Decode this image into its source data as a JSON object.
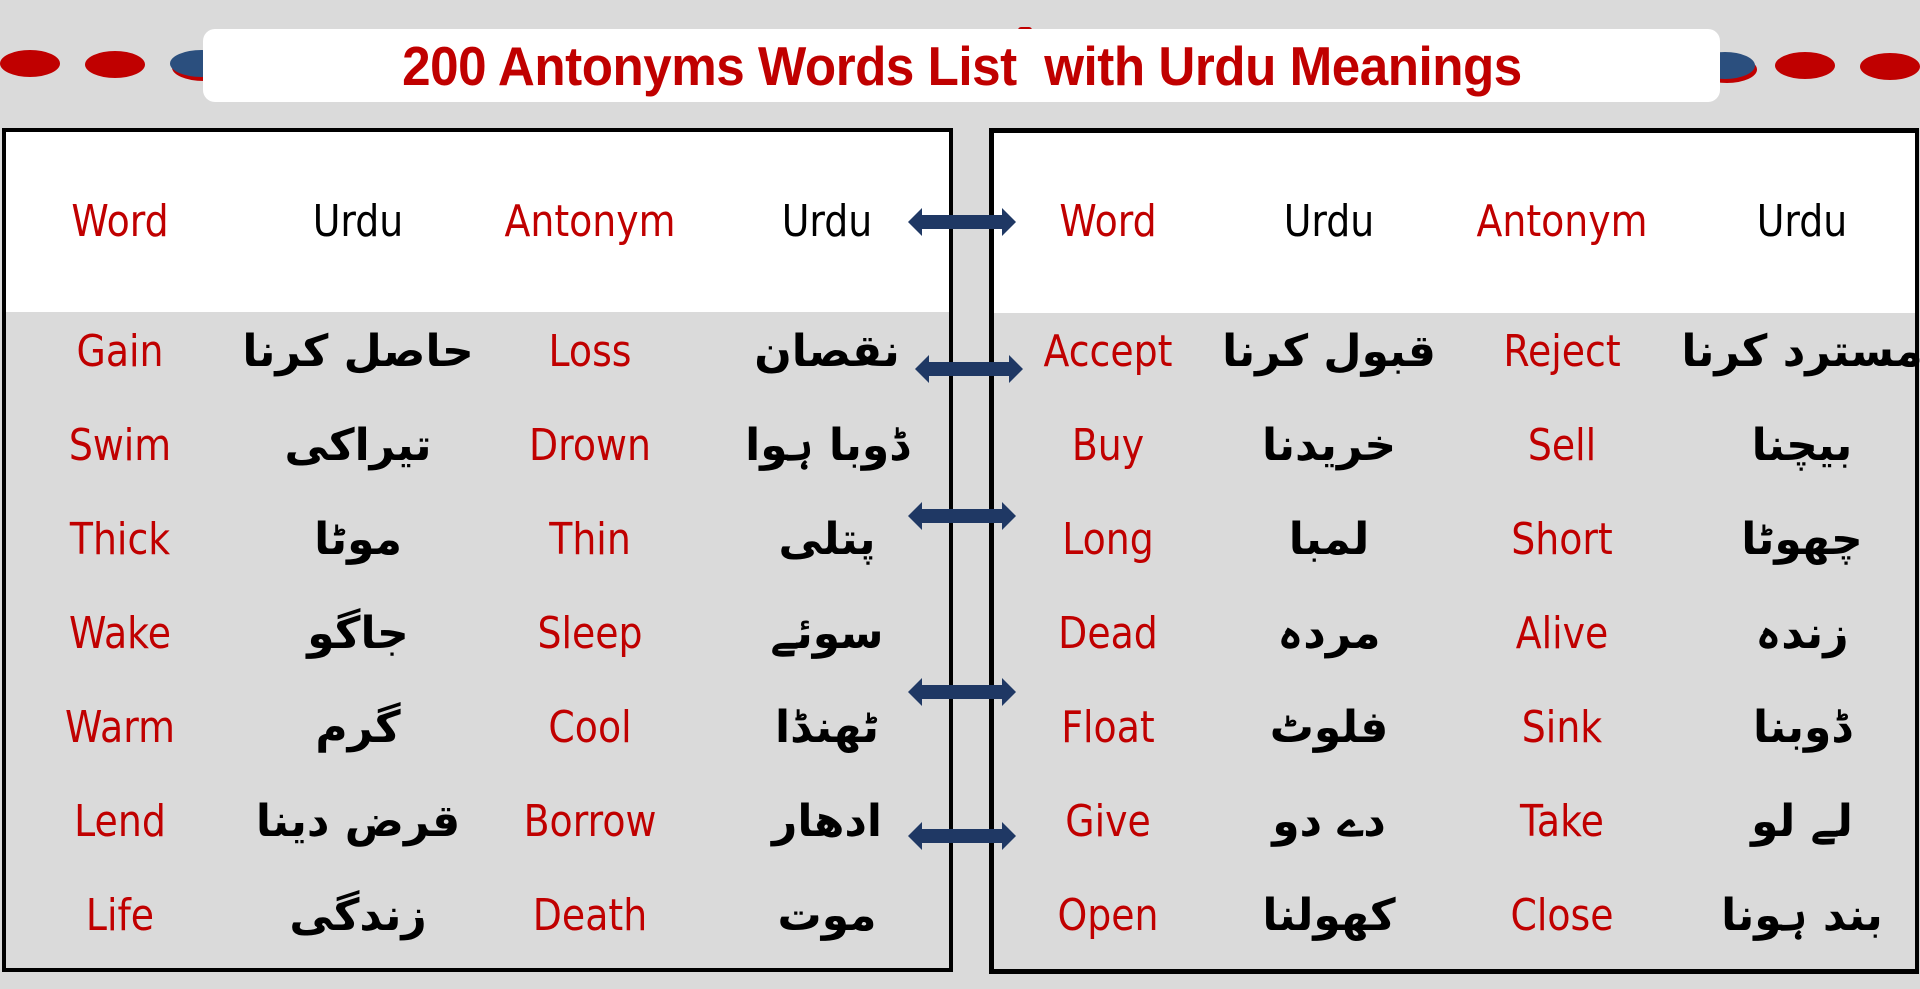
{
  "title": "200 Antonyms Words List  with Urdu Meanings",
  "colors": {
    "background": "#DADADA",
    "accent_red": "#C00000",
    "arrow_blue": "#1F3864",
    "dot_blue": "#2B4F7E"
  },
  "decor": {
    "left_dots": [
      "red-dot",
      "red-dot",
      "blue-dot"
    ],
    "right_dots": [
      "blue-dot",
      "red-dot",
      "red-dot"
    ],
    "connector_icon": "double-headed-arrow-icon"
  },
  "columns": [
    "Word",
    "Urdu",
    "Antonym",
    "Urdu"
  ],
  "left_table": {
    "headers": [
      "Word",
      "Urdu",
      "Antonym",
      "Urdu"
    ],
    "rows": [
      {
        "word": "Gain",
        "word_urdu": "حاصل کرنا",
        "antonym": "Loss",
        "antonym_urdu": "نقصان"
      },
      {
        "word": "Swim",
        "word_urdu": "تیراکی",
        "antonym": "Drown",
        "antonym_urdu": "ڈوبا ہوا"
      },
      {
        "word": "Thick",
        "word_urdu": "موٹا",
        "antonym": "Thin",
        "antonym_urdu": "پتلی"
      },
      {
        "word": "Wake",
        "word_urdu": "جاگو",
        "antonym": "Sleep",
        "antonym_urdu": "سوئے"
      },
      {
        "word": "Warm",
        "word_urdu": "گرم",
        "antonym": "Cool",
        "antonym_urdu": "ٹھنڈا"
      },
      {
        "word": "Lend",
        "word_urdu": "قرض دینا",
        "antonym": "Borrow",
        "antonym_urdu": "ادھار"
      },
      {
        "word": "Life",
        "word_urdu": "زندگی",
        "antonym": "Death",
        "antonym_urdu": "موت"
      }
    ]
  },
  "right_table": {
    "headers": [
      "Word",
      "Urdu",
      "Antonym",
      "Urdu"
    ],
    "rows": [
      {
        "word": "Accept",
        "word_urdu": "قبول کرنا",
        "antonym": "Reject",
        "antonym_urdu": "مسترد کرنا"
      },
      {
        "word": "Buy",
        "word_urdu": "خریدنا",
        "antonym": "Sell",
        "antonym_urdu": "بیچنا"
      },
      {
        "word": "Long",
        "word_urdu": "لمبا",
        "antonym": "Short",
        "antonym_urdu": "چھوٹا"
      },
      {
        "word": "Dead",
        "word_urdu": "مردہ",
        "antonym": "Alive",
        "antonym_urdu": "زندہ"
      },
      {
        "word": "Float",
        "word_urdu": "فلوٹ",
        "antonym": "Sink",
        "antonym_urdu": "ڈوبنا"
      },
      {
        "word": "Give",
        "word_urdu": "دے دو",
        "antonym": "Take",
        "antonym_urdu": "لے لو"
      },
      {
        "word": "Open",
        "word_urdu": "کھولنا",
        "antonym": "Close",
        "antonym_urdu": "بند ہونا"
      }
    ]
  }
}
